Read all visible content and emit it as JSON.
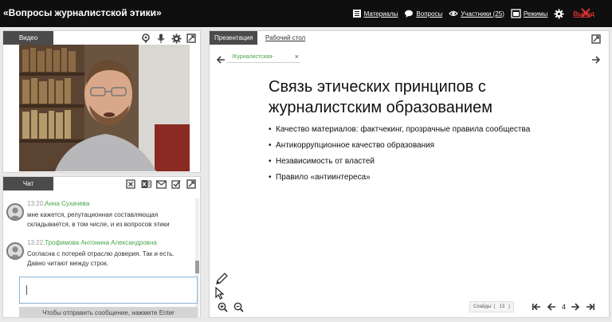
{
  "app": {
    "title": "«Вопросы журналистской этики»",
    "nav": {
      "materials": "Материалы",
      "questions": "Вопросы",
      "participants": "Участники (25)",
      "modes": "Режимы",
      "exit": "Выход"
    }
  },
  "video": {
    "tab_label": "Видео"
  },
  "chat": {
    "tab_label": "Чат",
    "messages": [
      {
        "time": "13:20,",
        "author": "Анна Сухачева",
        "text": "мне кажется, репутационная составляющая складывается, в том числе, и из вопросов этики"
      },
      {
        "time": "13:22,",
        "author": "Трофимова Антонина Александровна",
        "text": "Согласна с потерей отраслю доверия. Так и есть. Давно читают между строк."
      }
    ],
    "input_value": "",
    "send_hint": "Чтобы отправить сообщение, нажмите Enter"
  },
  "presentation": {
    "tab_presentation": "Презентация",
    "tab_desktop": "Рабочий стол",
    "doc_name": "Журналистская-",
    "doc_close": "×",
    "slide": {
      "title": "Связь этических принципов с журналистским образованием",
      "bullets": [
        "Качество материалов: фактчекинг, прозрачные правила сообщества",
        "Антикоррупционное качество образования",
        "Независимость от властей",
        "Правило «антиинтереса»"
      ]
    },
    "slides_label": "Слайды: (",
    "slides_total": "13",
    "slides_close": ")",
    "current_page": "4"
  },
  "colors": {
    "topbar": "#0f0f0f",
    "tab_active": "#4b4b4b",
    "author_green": "#4aa64a",
    "exit_red": "#e03333"
  }
}
